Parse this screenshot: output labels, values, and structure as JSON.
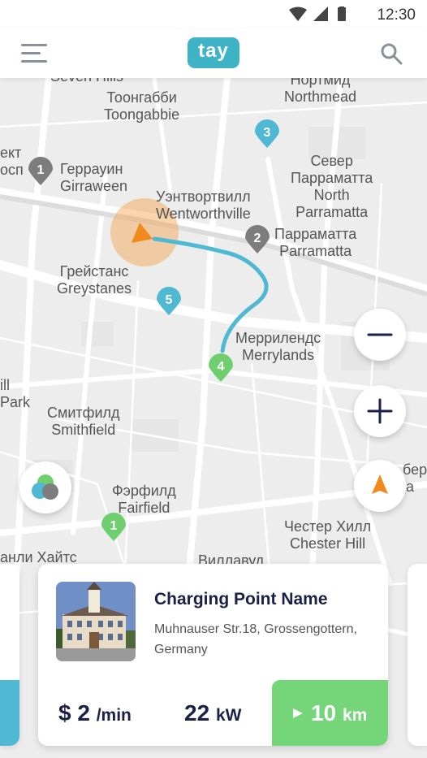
{
  "status_bar": {
    "time": "12:30",
    "icons": [
      "wifi-icon",
      "signal-icon",
      "battery-icon"
    ]
  },
  "app_bar": {
    "logo_text": "tay",
    "menu_icon": "hamburger-icon",
    "search_icon": "search-icon"
  },
  "map": {
    "labels": [
      {
        "id": "seven-hills",
        "text": "Seven Hills"
      },
      {
        "id": "northmead",
        "text": "Нортмид\nNorthmead"
      },
      {
        "id": "toongabbie",
        "text": "Тоонгабби\nToongabbie"
      },
      {
        "id": "girraween",
        "text": "Геррауин\nGirraween"
      },
      {
        "id": "prospect",
        "text": "ект\nосп"
      },
      {
        "id": "north-parramatta",
        "text": "Север\nПарраматта\nNorth\nParramatta"
      },
      {
        "id": "wentworthville",
        "text": "Уэнтвортвилл\nWentworthville"
      },
      {
        "id": "parramatta",
        "text": "Парраматта\nParramatta"
      },
      {
        "id": "greystanes",
        "text": "Грейстанс\nGreystanes"
      },
      {
        "id": "merrylands",
        "text": "Меррилендс\nMerrylands"
      },
      {
        "id": "park",
        "text": "ill\nPark"
      },
      {
        "id": "smithfield",
        "text": "Смитфилд\nSmithfield"
      },
      {
        "id": "fairfield",
        "text": "Фэрфилд\nFairfield"
      },
      {
        "id": "chester-hill",
        "text": "Честер Хилл\nChester Hill"
      },
      {
        "id": "berala",
        "text": "бер\nla"
      },
      {
        "id": "lansvale",
        "text": "анли Хайтс"
      },
      {
        "id": "villawood",
        "text": "Виллавуд"
      }
    ],
    "markers": [
      {
        "number": "1",
        "color": "#7d7d7d"
      },
      {
        "number": "2",
        "color": "#7d7d7d"
      },
      {
        "number": "3",
        "color": "#4fb8d3"
      },
      {
        "number": "4",
        "color": "#6fcf6f"
      },
      {
        "number": "5",
        "color": "#4fb8d3"
      },
      {
        "number": "1",
        "color": "#6fcf6f"
      }
    ],
    "route_color": "#4fb8d3",
    "location_color": "#f5a04a"
  },
  "controls": {
    "zoom_out_icon": "minus-icon",
    "zoom_in_icon": "plus-icon",
    "navigate_icon": "navigation-arrow-icon",
    "layers_icon": "layers-icon"
  },
  "card": {
    "name": "Charging Point Name",
    "address": "Muhnauser Str.18, Grossengottern, Germany",
    "price": "$ 2",
    "price_unit": "/min",
    "power": "22",
    "power_unit": "kW",
    "distance": "10",
    "distance_unit": "km",
    "accent": "#74d679"
  }
}
